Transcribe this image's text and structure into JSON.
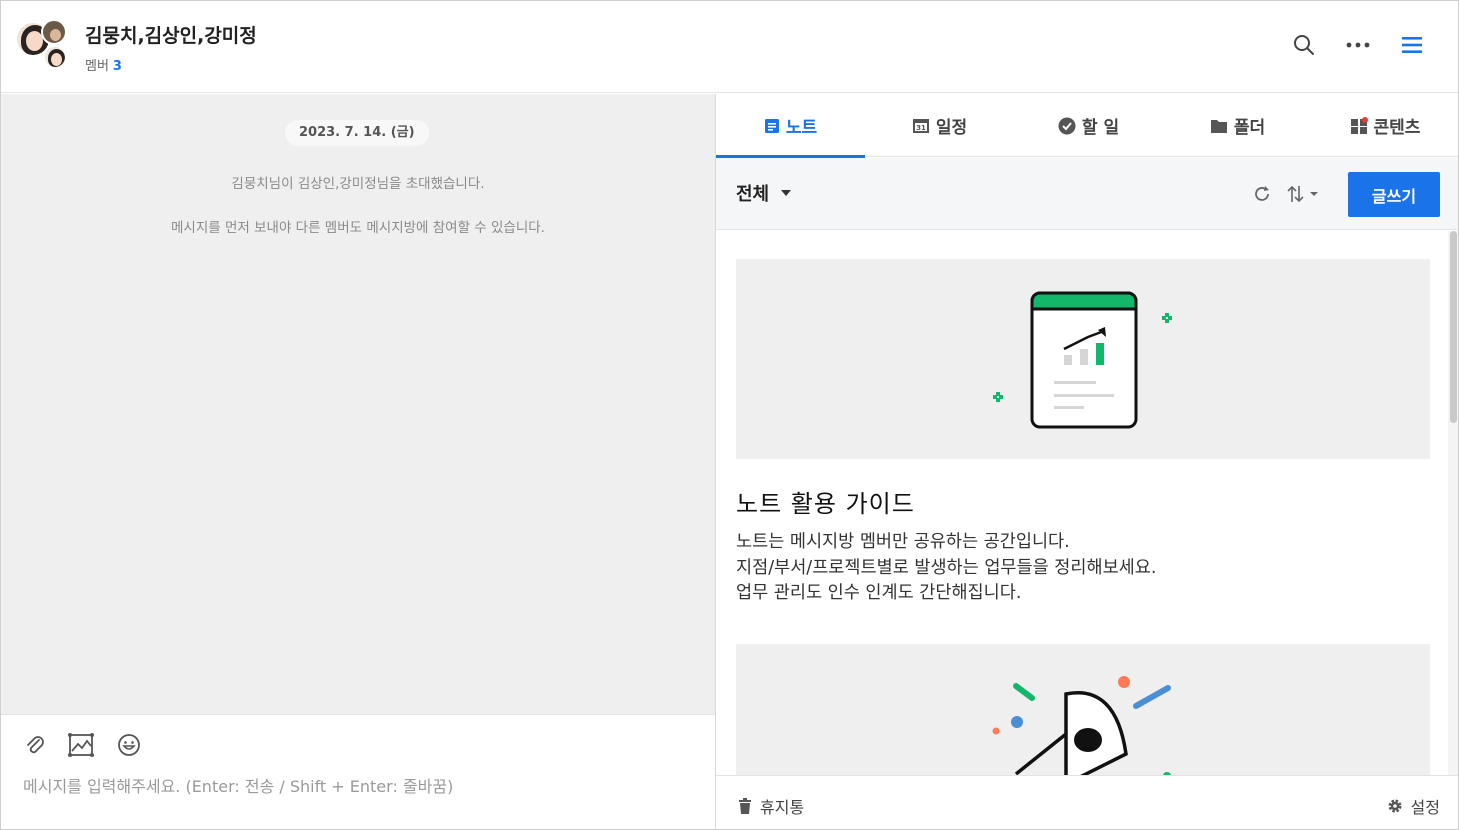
{
  "header": {
    "title": "김뭉치,김상인,강미정",
    "members_label": "멤버",
    "members_count": "3",
    "icons": [
      "search-icon",
      "more-icon",
      "menu-icon"
    ],
    "accent_color": "#1a73e8"
  },
  "chat": {
    "date": "2023. 7. 14. (금)",
    "system_messages": [
      "김뭉치님이 김상인,강미정님을 초대했습니다.",
      "메시지를 먼저 보내야 다른 멤버도 메시지방에 참여할 수 있습니다."
    ],
    "input_placeholder": "메시지를 입력해주세요. (Enter: 전송 / Shift + Enter: 줄바꿈)",
    "input_icons": [
      "attachment-icon",
      "image-icon",
      "emoji-icon"
    ]
  },
  "panel": {
    "tabs": [
      {
        "label": "노트",
        "icon": "note-icon",
        "active": true
      },
      {
        "label": "일정",
        "icon": "calendar-icon",
        "active": false
      },
      {
        "label": "할 일",
        "icon": "check-icon",
        "active": false
      },
      {
        "label": "폴더",
        "icon": "folder-icon",
        "active": false
      },
      {
        "label": "콘텐츠",
        "icon": "contents-icon",
        "active": false
      }
    ],
    "filter_label": "전체",
    "write_button": "글쓰기",
    "guide": {
      "title": "노트 활용 가이드",
      "lines": [
        "노트는 메시지방 멤버만 공유하는 공간입니다.",
        "지점/부서/프로젝트별로 발생하는 업무들을 정리해보세요.",
        "업무 관리도 인수 인계도 간단해집니다."
      ]
    },
    "footer": {
      "trash_label": "휴지통",
      "settings_label": "설정"
    }
  }
}
